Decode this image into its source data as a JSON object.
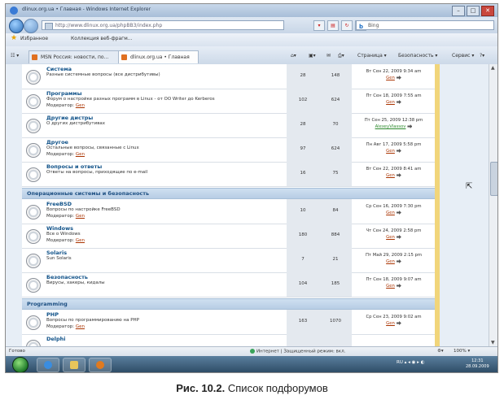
{
  "window": {
    "title": "dlinux.org.ua • Главная - Windows Internet Explorer",
    "url": "http://www.dlinux.org.ua/phpBB3/index.php",
    "search_text": "Bing"
  },
  "favorites_bar": {
    "favorites_label": "Избранное",
    "suggested_label": "Коллекция веб-фрагм..."
  },
  "tabs": [
    {
      "label": "MSN Россия: новости, по..."
    },
    {
      "label": "dlinux.org.ua • Главная"
    }
  ],
  "command_bar": {
    "page": "Страница ▾",
    "safety": "Безопасность ▾",
    "tools": "Сервис ▾",
    "help": "?▾"
  },
  "sections": [
    {
      "title": "",
      "forums": [
        {
          "name": "Система",
          "desc": "Разные системные вопросы (все дистрибутивы)",
          "moderator": "",
          "topics": "28",
          "posts": "148",
          "last_date": "Вт Сен 22, 2009 9:34 am",
          "last_user": "Gen"
        },
        {
          "name": "Программы",
          "desc": "Форум о настройке разных программ в Linux - от OO Writer до Kerberos",
          "moderator": "Gen",
          "topics": "102",
          "posts": "624",
          "last_date": "Пт Сен 18, 2009 7:55 am",
          "last_user": "Gen"
        },
        {
          "name": "Другие дистры",
          "desc": "О других дистрибутивах",
          "moderator": "",
          "topics": "28",
          "posts": "70",
          "last_date": "Пт Сен 25, 2009 12:38 pm",
          "last_user": "AlexeyVlassov"
        },
        {
          "name": "Другое",
          "desc": "Остальные вопросы, связанные с Linux",
          "moderator": "Gen",
          "topics": "97",
          "posts": "624",
          "last_date": "Пн Авг 17, 2009 5:58 pm",
          "last_user": "Gen"
        },
        {
          "name": "Вопросы и ответы",
          "desc": "Ответы на вопросы, приходящие по e-mail",
          "moderator": "",
          "topics": "16",
          "posts": "75",
          "last_date": "Вт Сен 22, 2009 8:41 am",
          "last_user": "Gen"
        }
      ]
    },
    {
      "title": "Операционные системы и безопасность",
      "forums": [
        {
          "name": "FreeBSD",
          "desc": "Вопросы по настройке FreeBSD",
          "moderator": "Gen",
          "topics": "10",
          "posts": "84",
          "last_date": "Ср Сен 16, 2009 7:30 pm",
          "last_user": "Gen"
        },
        {
          "name": "Windows",
          "desc": "Все о Windows",
          "moderator": "Gen",
          "topics": "180",
          "posts": "884",
          "last_date": "Чт Сен 24, 2009 2:58 pm",
          "last_user": "Gen"
        },
        {
          "name": "Solaris",
          "desc": "Sun Solaris",
          "moderator": "",
          "topics": "7",
          "posts": "21",
          "last_date": "Пт Май 29, 2009 2:15 pm",
          "last_user": "Gen"
        },
        {
          "name": "Безопасность",
          "desc": "Вирусы, хакеры, кидалы",
          "moderator": "",
          "topics": "104",
          "posts": "185",
          "last_date": "Пт Сен 18, 2009 9:07 am",
          "last_user": "Gen"
        }
      ]
    },
    {
      "title": "Programming",
      "forums": [
        {
          "name": "PHP",
          "desc": "Вопросы по программированию на PHP",
          "moderator": "Gen",
          "topics": "163",
          "posts": "1070",
          "last_date": "Ср Сен 23, 2009 9:02 am",
          "last_user": "Gen"
        },
        {
          "name": "Delphi",
          "desc": "",
          "moderator": "",
          "topics": "",
          "posts": "",
          "last_date": "",
          "last_user": ""
        }
      ]
    }
  ],
  "labels": {
    "moderator_prefix": "Модератор:"
  },
  "status_bar": {
    "left": "Готово",
    "zone": "Интернет | Защищенный режим: вкл.",
    "zoom": "100% ▾"
  },
  "taskbar": {
    "tray": "RU",
    "time": "12:31",
    "date": "28.09.2009"
  },
  "caption": {
    "label": "Рис. 10.2.",
    "text": " Список подфорумов"
  }
}
